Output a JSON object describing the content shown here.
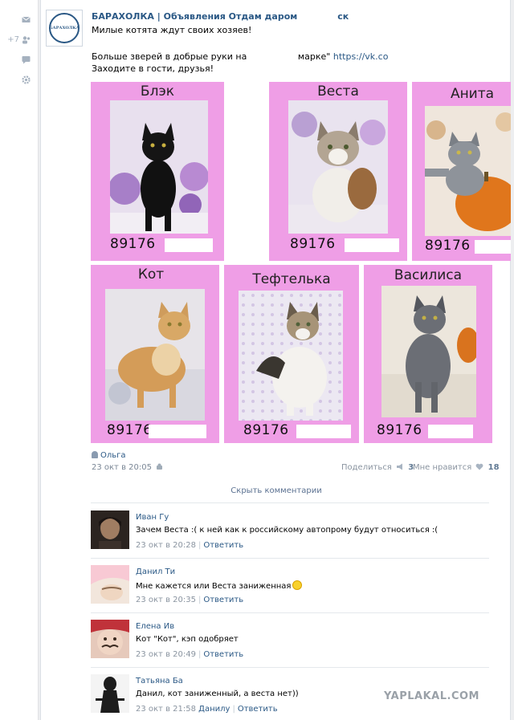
{
  "left_menu": {
    "count_badge": "+7"
  },
  "post": {
    "group_name": "БАРАХОЛКА | Объявления Отдам даром",
    "group_name_tail": "ск",
    "logo_text": "БАРАХОЛКА",
    "line1": "Милые котята ждут своих хозяев!",
    "line2_start": "Больше зверей в добрые руки на",
    "line2_mid": "марке\"",
    "line2_link": "https://vk.co",
    "line3": "Заходите в гости, друзья!",
    "cards": [
      {
        "name": "Блэк",
        "phone": "89176"
      },
      {
        "name": "Веста",
        "phone": "89176"
      },
      {
        "name": "Анита",
        "phone": "89176"
      },
      {
        "name": "Кот",
        "phone": "89176"
      },
      {
        "name": "Тефтелька",
        "phone": "89176"
      },
      {
        "name": "Василиса",
        "phone": "89176"
      }
    ],
    "author": "Ольга",
    "date": "23 окт в 20:05",
    "share_label": "Поделиться",
    "share_count": "3",
    "like_label": "Мне нравится",
    "like_count": "18",
    "hide_comments": "Скрыть комментарии"
  },
  "comments": [
    {
      "name": "Иван Гу",
      "text": "Зачем Веста :( к ней как к российскому автопрому будут относиться :(",
      "date": "23 окт в 20:28",
      "reply_to": "",
      "reply": "Ответить"
    },
    {
      "name": "Данил Ти",
      "text": "Мне кажется или Веста заниженная",
      "date": "23 окт в 20:35",
      "reply_to": "",
      "reply": "Ответить"
    },
    {
      "name": "Елена Ив",
      "text": "Кот \"Кот\", кэп одобряет",
      "date": "23 окт в 20:49",
      "reply_to": "",
      "reply": "Ответить"
    },
    {
      "name": "Татьяна Ба",
      "text": "Данил, кот заниженный, а веста нет))",
      "date": "23 окт в 21:58",
      "reply_to": "Данилу",
      "reply": "Ответить"
    }
  ],
  "watermark": "YAPLAKAL.COM",
  "colors": {
    "card_pink": "#ef9ee6",
    "link_blue": "#2a5885",
    "page_bg": "#edeef0"
  }
}
